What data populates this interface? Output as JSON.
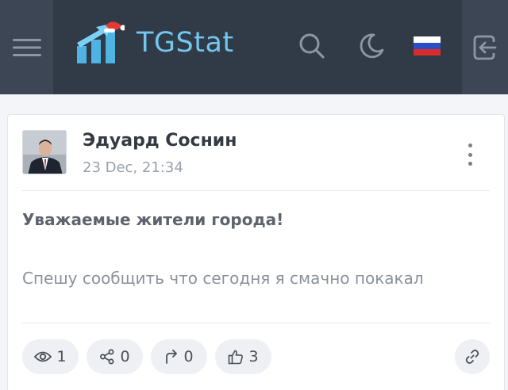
{
  "header": {
    "brand": "TGStat",
    "icons": {
      "menu": "hamburger-menu-icon",
      "logo": "tgstat-logo-icon",
      "search": "search-icon",
      "theme": "moon-icon",
      "language": "russian-flag-icon",
      "logout": "logout-icon"
    }
  },
  "post": {
    "author": "Эдуард Соснин",
    "date": "23 Dec, 21:34",
    "title": "Уважаемые жители города!",
    "body": "Спешу сообщить что сегодня я смачно покакал"
  },
  "stats": {
    "views": "1",
    "shares": "0",
    "forwards": "0",
    "reactions": "3"
  },
  "colors": {
    "header_bg": "#313a47",
    "header_side_bg": "#3d4654",
    "brand": "#72c7ef",
    "page_bg": "#f4f5f8",
    "pill_bg": "#eef0f4"
  }
}
